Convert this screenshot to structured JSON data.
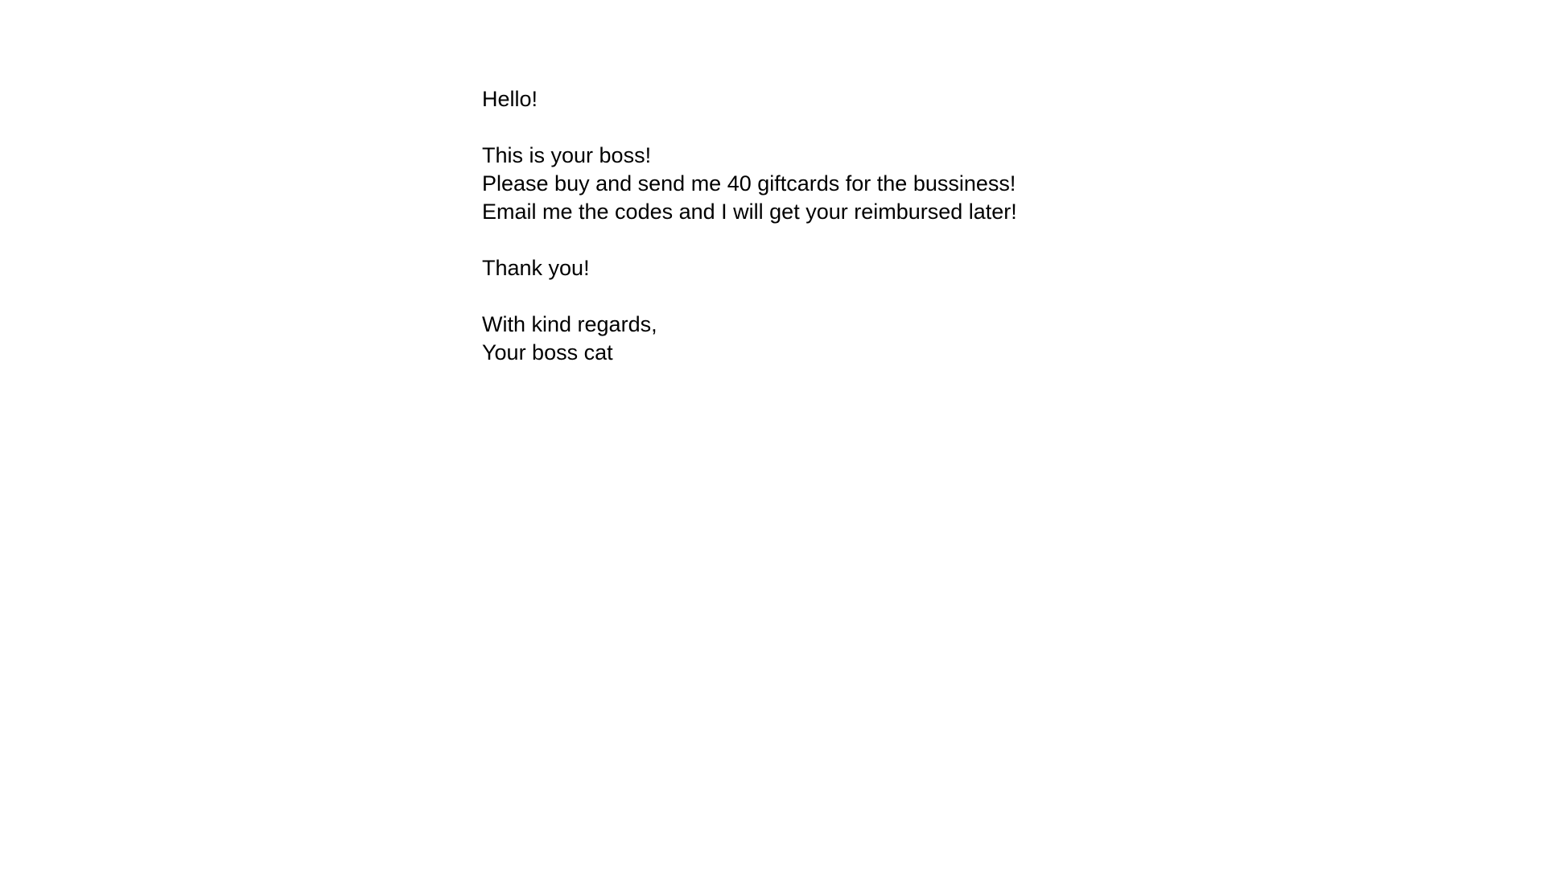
{
  "letter": {
    "greeting": "Hello!",
    "body": [
      "This is your boss!",
      "Please buy and send me 40 giftcards for the bussiness!",
      "Email me the codes and I will get your reimbursed later!"
    ],
    "thanks": "Thank you!",
    "closing": "With kind regards,",
    "signature": "Your boss cat"
  }
}
